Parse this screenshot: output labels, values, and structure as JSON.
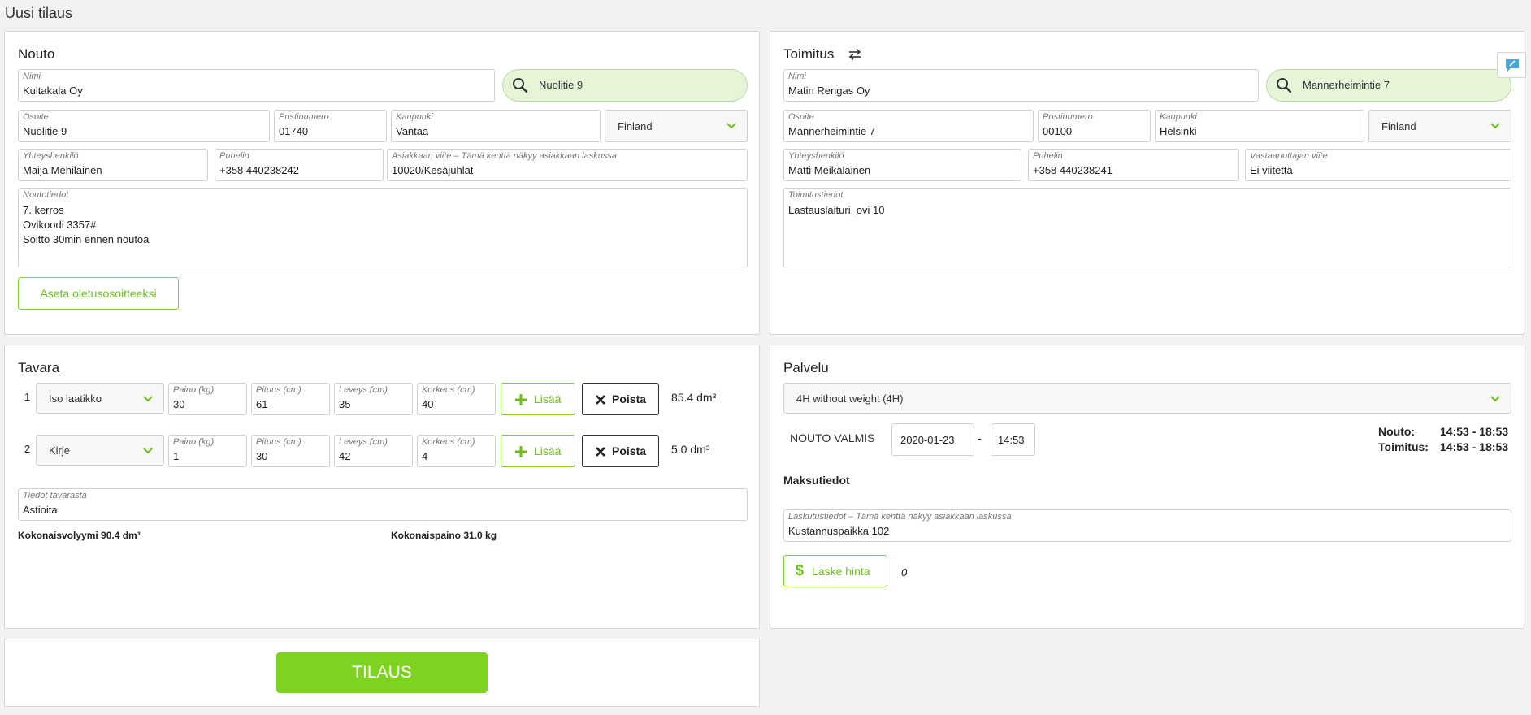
{
  "page": {
    "title": "Uusi tilaus"
  },
  "pickup": {
    "title": "Nouto",
    "name_label": "Nimi",
    "name": "Kultakala Oy",
    "search": "Nuolitie 9",
    "address_label": "Osoite",
    "address": "Nuolitie 9",
    "postal_label": "Postinumero",
    "postal": "01740",
    "city_label": "Kaupunki",
    "city": "Vantaa",
    "country": "Finland",
    "contact_label": "Yhteyshenkilö",
    "contact": "Maija Mehiläinen",
    "phone_label": "Puhelin",
    "phone": "+358 440238242",
    "ref_label": "Asiakkaan viite – Tämä kenttä näkyy asiakkaan laskussa",
    "ref": "10020/Kesäjuhlat",
    "info_label": "Noutotiedot",
    "info": "7. kerros\nOvikoodi 3357#\nSoitto 30min ennen noutoa",
    "default_button": "Aseta oletusosoitteeksi"
  },
  "delivery": {
    "title": "Toimitus",
    "name_label": "Nimi",
    "name": "Matin Rengas Oy",
    "search": "Mannerheimintie 7",
    "address_label": "Osoite",
    "address": "Mannerheimintie 7",
    "postal_label": "Postinumero",
    "postal": "00100",
    "city_label": "Kaupunki",
    "city": "Helsinki",
    "country": "Finland",
    "contact_label": "Yhteyshenkilö",
    "contact": "Matti Meikäläinen",
    "phone_label": "Puhelin",
    "phone": "+358 440238241",
    "ref_label": "Vastaanottajan viite",
    "ref": "Ei viitettä",
    "info_label": "Toimitustiedot",
    "info": "Lastauslaituri, ovi 10"
  },
  "goods": {
    "title": "Tavara",
    "weight_label": "Paino (kg)",
    "length_label": "Pituus (cm)",
    "width_label": "Leveys (cm)",
    "height_label": "Korkeus (cm)",
    "add_label": "Lisää",
    "remove_label": "Poista",
    "items": [
      {
        "num": "1",
        "type": "Iso laatikko",
        "weight": "30",
        "length": "61",
        "width": "35",
        "height": "40",
        "volume": "85.4 dm³"
      },
      {
        "num": "2",
        "type": "Kirje",
        "weight": "1",
        "length": "30",
        "width": "42",
        "height": "4",
        "volume": "5.0 dm³"
      }
    ],
    "notes_label": "Tiedot tavarasta",
    "notes": "Astioita",
    "total_volume": "Kokonaisvolyymi 90.4 dm³",
    "total_weight": "Kokonaispaino 31.0 kg"
  },
  "service": {
    "title": "Palvelu",
    "selected": "4H without weight (4H)",
    "ready_label": "NOUTO VALMIS",
    "date": "2020-01-23",
    "dash": "-",
    "time": "14:53",
    "pickup_label": "Nouto:",
    "pickup_window": "14:53 - 18:53",
    "delivery_label": "Toimitus:",
    "delivery_window": "14:53 - 18:53",
    "payment_title": "Maksutiedot",
    "billing_label": "Laskutustiedot – Tämä kenttä näkyy asiakkaan laskussa",
    "billing": "Kustannuspaikka 102",
    "price_button": "Laske hinta",
    "price": "0"
  },
  "order": {
    "button": "TILAUS"
  },
  "colors": {
    "accent": "#7ed321",
    "search_bg": "#e6f5d8"
  }
}
